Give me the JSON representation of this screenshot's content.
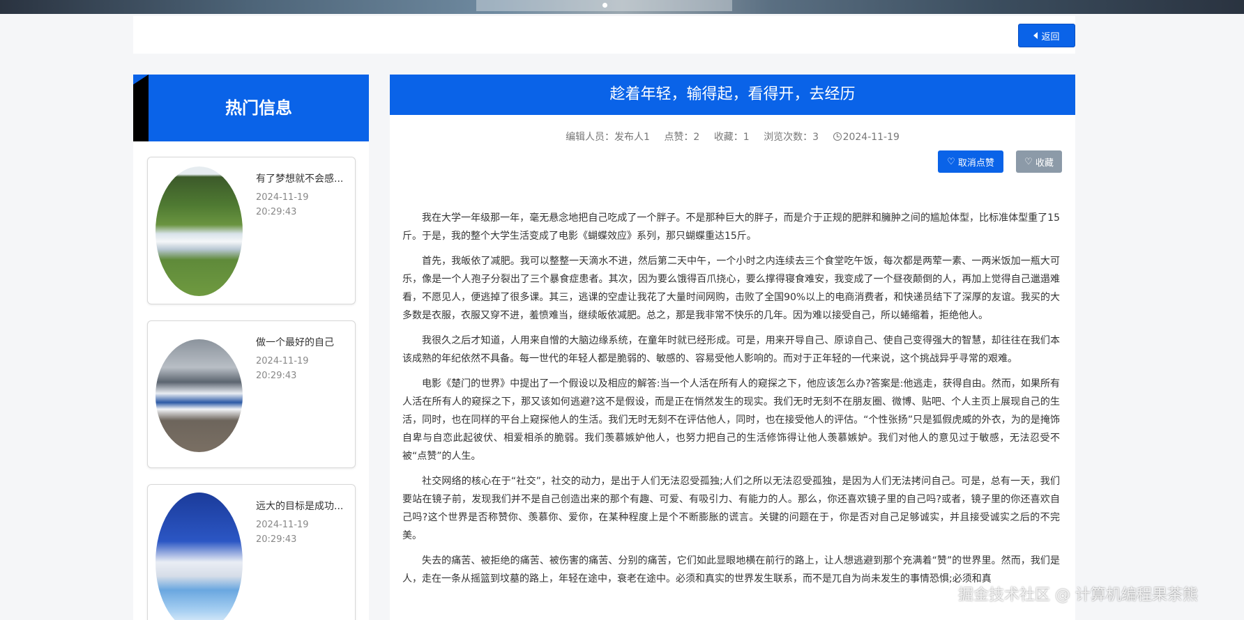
{
  "header": {
    "back_label": "返回"
  },
  "sidebar": {
    "title": "热门信息",
    "items": [
      {
        "title": "有了梦想就不会感...",
        "date": "2024-11-19",
        "time": "20:29:43"
      },
      {
        "title": "做一个最好的自己",
        "date": "2024-11-19",
        "time": "20:29:43"
      },
      {
        "title": "远大的目标是成功...",
        "date": "2024-11-19",
        "time": "20:29:43"
      }
    ]
  },
  "article": {
    "title": "趁着年轻，输得起，看得开，去经历",
    "meta": {
      "editor": "编辑人员：发布人1",
      "likes": "点赞：2",
      "favorites": "收藏：1",
      "views": "浏览次数：3",
      "date": "2024-11-19"
    },
    "like_button": "取消点赞",
    "favorite_button": "收藏",
    "paragraphs": [
      "我在大学一年级那一年，毫无悬念地把自己吃成了一个胖子。不是那种巨大的胖子，而是介于正规的肥胖和臃肿之间的尴尬体型，比标准体型重了15斤。于是，我的整个大学生活变成了电影《蝴蝶效应》系列，那只蝴蝶重达15斤。",
      "首先，我皈依了减肥。我可以整整一天滴水不进，然后第二天中午，一个小时之内连续去三个食堂吃午饭，每次都是两荤一素、一两米饭加一瓶大可乐，像是一个人孢子分裂出了三个暴食症患者。其次，因为要么饿得百爪挠心，要么撑得寝食难安，我变成了一个昼夜颠倒的人，再加上觉得自己邋遢难看，不愿见人，便逃掉了很多课。其三，逃课的空虚让我花了大量时间网购，击败了全国90%以上的电商消费者，和快递员结下了深厚的友谊。我买的大多数是衣服，衣服又穿不进，羞愤难当，继续皈依减肥。总之，那是我非常不快乐的几年。因为难以接受自己，所以蜷缩着，拒绝他人。",
      "我很久之后才知道，人用来自憎的大脑边缘系统，在童年时就已经形成。可是，用来开导自己、原谅自己、使自己变得强大的智慧，却往往在我们本该成熟的年纪依然不具备。每一世代的年轻人都是脆弱的、敏感的、容易受他人影响的。而对于正年轻的一代来说，这个挑战异乎寻常的艰难。",
      "电影《楚门的世界》中提出了一个假设以及相应的解答:当一个人活在所有人的窥探之下，他应该怎么办?答案是:他逃走，获得自由。然而，如果所有人活在所有人的窥探之下，那又该如何逃避?这不是假设，而是正在悄然发生的现实。我们无时无刻不在朋友圈、微博、贴吧、个人主页上展现自己的生活，同时，也在同样的平台上窥探他人的生活。我们无时无刻不在评估他人，同时，也在接受他人的评估。“个性张扬”只是狐假虎威的外衣，为的是掩饰自卑与自恋此起彼伏、相爱相杀的脆弱。我们羡慕嫉妒他人，也努力把自己的生活修饰得让他人羡慕嫉妒。我们对他人的意见过于敏感，无法忍受不被“点赞”的人生。",
      "社交网络的核心在于“社交”，社交的动力，是出于人们无法忍受孤独;人们之所以无法忍受孤独，是因为人们无法拷问自己。可是，总有一天，我们要站在镜子前，发现我们并不是自己创造出来的那个有趣、可爱、有吸引力、有能力的人。那么，你还喜欢镜子里的自己吗?或者，镜子里的你还喜欢自己吗?这个世界是否称赞你、羡慕你、爱你，在某种程度上是个不断膨胀的谎言。关键的问题在于，你是否对自己足够诚实，并且接受诚实之后的不完美。",
      "失去的痛苦、被拒绝的痛苦、被伤害的痛苦、分别的痛苦，它们如此显眼地横在前行的路上，让人想逃避到那个充满着“赞”的世界里。然而，我们是人，走在一条从摇篮到坟墓的路上，年轻在途中，衰老在途中。必须和真实的世界发生联系，而不是兀自为尚未发生的事情恐惧;必须和真"
    ]
  },
  "watermark": "掘金技术社区 @ 计算机编程果茶熊"
}
